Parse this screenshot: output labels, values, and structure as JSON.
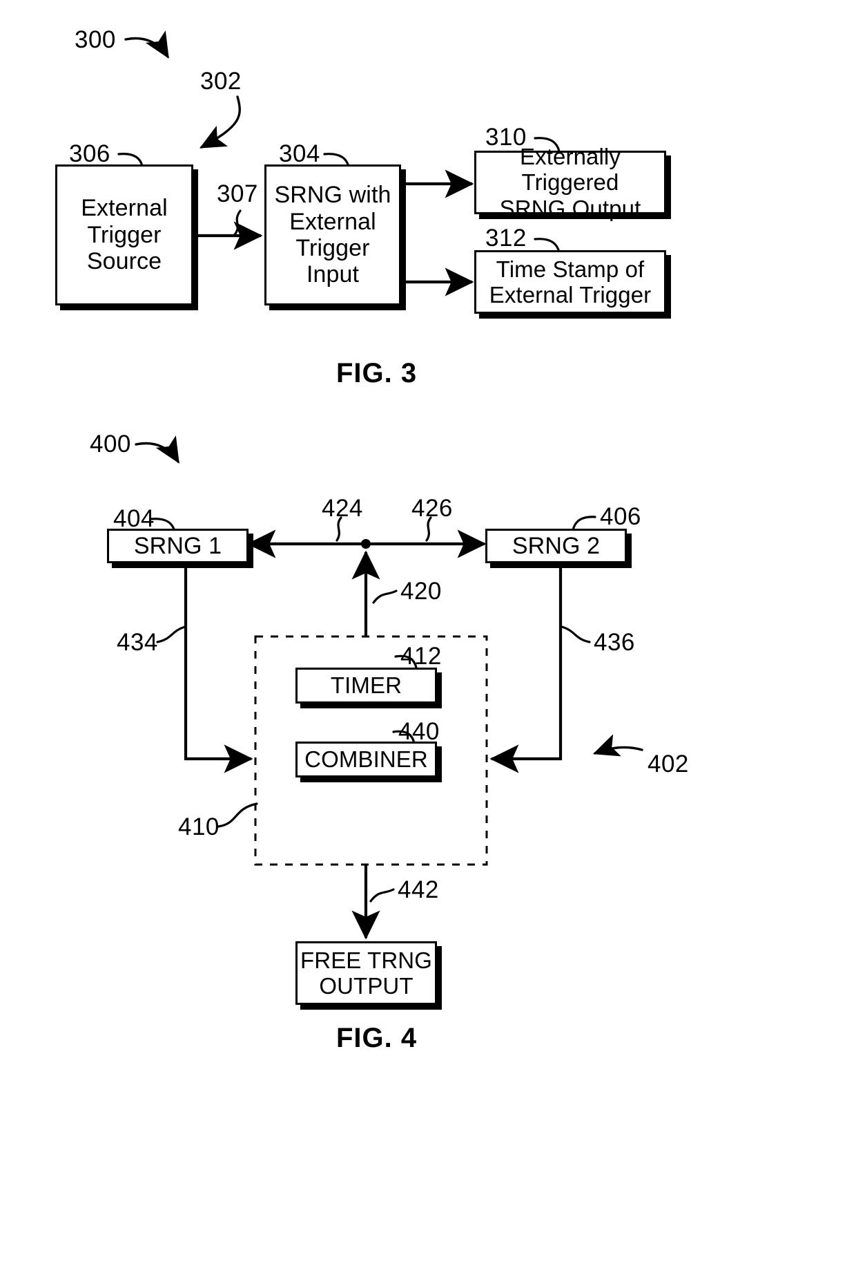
{
  "document": {
    "type": "patent-figure-sheet",
    "figures": [
      "FIG. 3",
      "FIG. 4"
    ]
  },
  "fig3": {
    "caption": "FIG. 3",
    "system_label": "300",
    "subsystem_label": "302",
    "boxes": [
      {
        "ref": "306",
        "label": "External\nTrigger\nSource"
      },
      {
        "ref": "304",
        "label": "SRNG with\nExternal\nTrigger\nInput"
      },
      {
        "ref": "310",
        "label": "Externally Triggered\nSRNG Output"
      },
      {
        "ref": "312",
        "label": "Time Stamp of\nExternal Trigger"
      }
    ],
    "box_306_line1": "External",
    "box_306_line2": "Trigger",
    "box_306_line3": "Source",
    "box_304_line1": "SRNG with",
    "box_304_line2": "External",
    "box_304_line3": "Trigger",
    "box_304_line4": "Input",
    "box_310_line1": "Externally Triggered",
    "box_310_line2": "SRNG Output",
    "box_312_line1": "Time Stamp of",
    "box_312_line2": "External Trigger",
    "connectors": [
      {
        "ref": "307",
        "from": "306",
        "to": "304",
        "style": "arrow-right"
      },
      {
        "ref": "",
        "from": "304",
        "to": "310",
        "style": "arrow-right"
      },
      {
        "ref": "",
        "from": "304",
        "to": "312",
        "style": "arrow-right"
      }
    ],
    "connector_307_label": "307"
  },
  "fig4": {
    "caption": "FIG. 4",
    "system_label": "400",
    "subsystem_label": "402",
    "boxes": [
      {
        "ref": "404",
        "label": "SRNG 1"
      },
      {
        "ref": "406",
        "label": "SRNG 2"
      },
      {
        "ref": "412",
        "label": "TIMER"
      },
      {
        "ref": "440",
        "label": "COMBINER"
      },
      {
        "ref": "442",
        "label": "FREE TRNG\nOUTPUT"
      }
    ],
    "box_404_label": "SRNG 1",
    "box_406_label": "SRNG 2",
    "box_412_label": "TIMER",
    "box_440_label": "COMBINER",
    "box_out_line1": "FREE TRNG",
    "box_out_line2": "OUTPUT",
    "dashed_container_ref": "410",
    "connectors": [
      {
        "ref": "424",
        "description": "timer bus to SRNG 1",
        "style": "arrow-left"
      },
      {
        "ref": "426",
        "description": "timer bus to SRNG 2",
        "style": "arrow-right"
      },
      {
        "ref": "420",
        "description": "timer block up to bus junction",
        "style": "arrow-up"
      },
      {
        "ref": "434",
        "description": "SRNG 1 output into combiner",
        "style": "arrow-right"
      },
      {
        "ref": "436",
        "description": "SRNG 2 output into combiner",
        "style": "arrow-left"
      },
      {
        "ref": "442",
        "description": "combiner block to free TRNG output",
        "style": "arrow-down"
      }
    ],
    "connector_420_label": "420",
    "connector_424_label": "424",
    "connector_426_label": "426",
    "connector_434_label": "434",
    "connector_436_label": "436",
    "connector_442_label": "442"
  }
}
